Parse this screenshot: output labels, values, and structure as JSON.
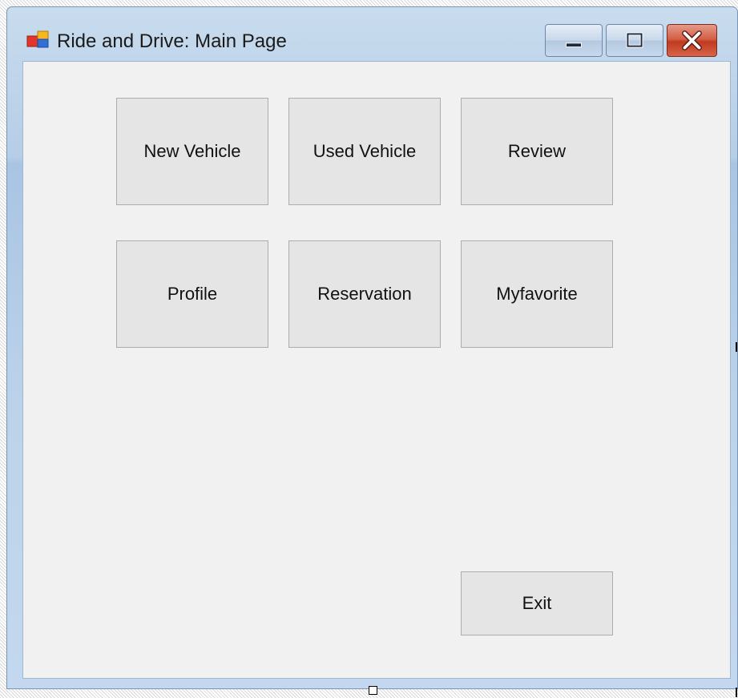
{
  "window": {
    "title": "Ride and Drive: Main Page",
    "icon": "winforms-app-icon",
    "controls": {
      "minimize": "minimize-icon",
      "maximize": "maximize-icon",
      "close": "close-icon"
    }
  },
  "buttons": {
    "new_vehicle": "New Vehicle",
    "used_vehicle": "Used Vehicle",
    "review": "Review",
    "profile": "Profile",
    "reservation": "Reservation",
    "myfavorite": "Myfavorite",
    "exit": "Exit"
  },
  "colors": {
    "titlebar": "#b5cde6",
    "client_background": "#f1f1f1",
    "button_face": "#e5e5e5",
    "button_border": "#adadad",
    "close_button": "#c94a2f"
  }
}
